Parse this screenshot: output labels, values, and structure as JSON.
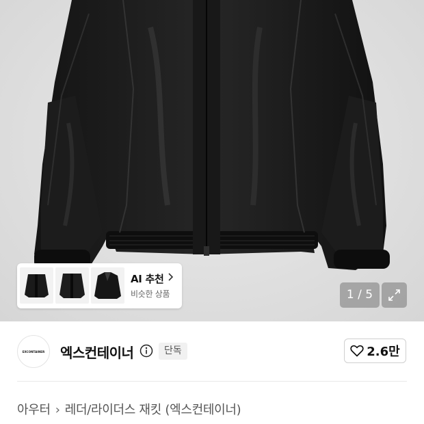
{
  "gallery": {
    "counter": "1 / 5",
    "ai_recommend": {
      "title": "AI 추천",
      "subtitle": "비슷한 상품"
    }
  },
  "brand": {
    "logo_text": "EXCONTAINER",
    "name": "엑스컨테이너",
    "tag": "단독"
  },
  "like": {
    "count": "2.6만"
  },
  "breadcrumb": {
    "category": "아우터",
    "subcategory": "레더/라이더스 재킷 (엑스컨테이너)"
  },
  "icons": [
    "chevron-right-icon",
    "expand-icon",
    "info-icon",
    "heart-icon"
  ]
}
